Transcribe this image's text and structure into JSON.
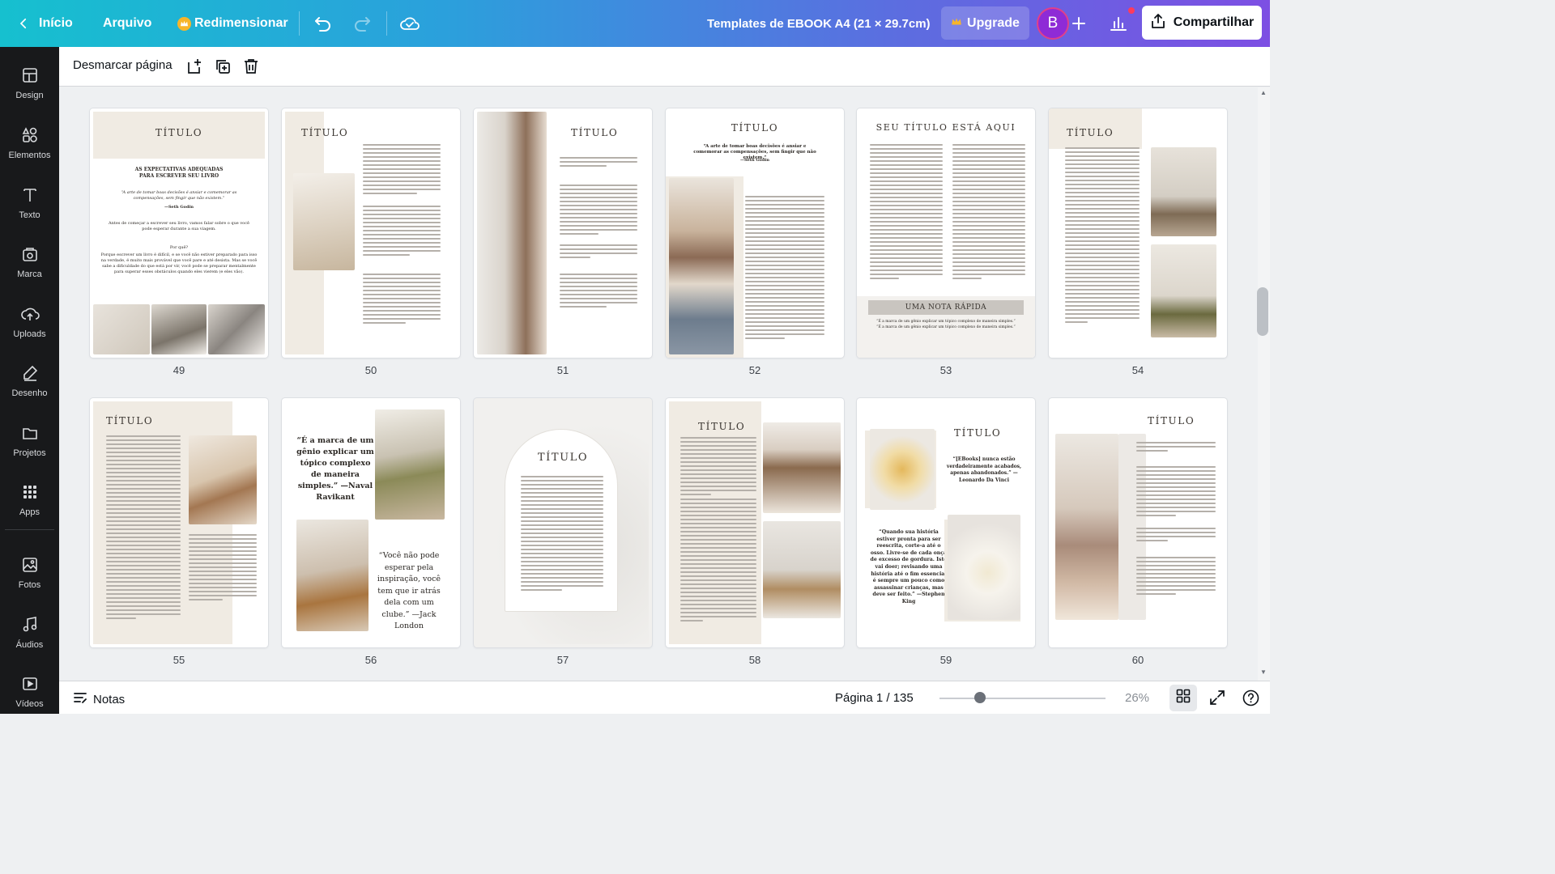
{
  "topbar": {
    "home_label": "Início",
    "file_label": "Arquivo",
    "resize_label": "Redimensionar",
    "doc_title": "Templates de EBOOK A4 (21 × 29.7cm)",
    "upgrade_label": "Upgrade",
    "avatar_initial": "B",
    "share_label": "Compartilhar",
    "brand_color": "#7d4fe3"
  },
  "sidebar": {
    "items": [
      {
        "label": "Design",
        "icon": "layout-icon"
      },
      {
        "label": "Elementos",
        "icon": "shapes-icon"
      },
      {
        "label": "Texto",
        "icon": "text-icon"
      },
      {
        "label": "Marca",
        "icon": "brand-icon"
      },
      {
        "label": "Uploads",
        "icon": "cloud-upload-icon"
      },
      {
        "label": "Desenho",
        "icon": "draw-icon"
      },
      {
        "label": "Projetos",
        "icon": "folder-icon"
      },
      {
        "label": "Apps",
        "icon": "apps-grid-icon"
      },
      {
        "label": "Fotos",
        "icon": "photo-icon"
      },
      {
        "label": "Áudios",
        "icon": "music-icon"
      },
      {
        "label": "Vídeos",
        "icon": "video-icon"
      }
    ]
  },
  "toolbar": {
    "deselect_label": "Desmarcar página"
  },
  "pages": {
    "p49": {
      "num": "49",
      "title": "TÍTULO",
      "heading": "AS EXPECTATIVAS ADEQUADAS PARA ESCREVER SEU LIVRO",
      "quote": "“A arte de tomar boas decisões é ansiar e comemorar as compensações, sem fingir que não existem.”",
      "author": "—Seth Godin",
      "body1": "Antes de começar a escrever seu livro, vamos falar sobre o que você pode esperar durante a sua viagem.",
      "question": "Por quê?",
      "body2": "Porque escrever um livro é difícil, e se você não estiver preparado para isso na verdade, é muito mais provável que você pare e até desista. Mas se você sabe a dificuldade do que está por vir, você pode se preparar mentalmente para superar esses obstáculos quando eles vierem (e eles vão)."
    },
    "p50": {
      "num": "50",
      "title": "TÍTULO"
    },
    "p51": {
      "num": "51",
      "title": "TÍTULO"
    },
    "p52": {
      "num": "52",
      "title": "TÍTULO",
      "quote": "“A arte de tomar boas decisões é ansiar e comemorar as compensações, sem fingir que não existem.”",
      "author": "—Seth Godin"
    },
    "p53": {
      "num": "53",
      "title": "SEU TÍTULO ESTÁ AQUI",
      "note_title": "UMA NOTA RÁPIDA",
      "note_line": "“É a marca de um gênio explicar um tópico complexo de maneira simples.”"
    },
    "p54": {
      "num": "54",
      "title": "TÍTULO"
    },
    "p55": {
      "num": "55",
      "title": "TÍTULO"
    },
    "p56": {
      "num": "56",
      "quote1": "“É a marca de um gênio explicar um tópico complexo de maneira simples.” —Naval Ravikant",
      "quote2": "“Você não pode esperar pela inspiração, você tem que ir atrás dela com um clube.” —Jack London"
    },
    "p57": {
      "num": "57",
      "title": "TÍTULO"
    },
    "p58": {
      "num": "58",
      "title": "TÍTULO"
    },
    "p59": {
      "num": "59",
      "title": "TÍTULO",
      "quote1": "“[EBooks] nunca estão verdadeiramente acabados, apenas abandonados.” — Leonardo Da Vinci",
      "quote2": "“Quando sua história estiver pronta para ser reescrita, corte-a até o osso. Livre-se de cada onça de excesso de gordura. Isto vai doer; revisando uma história até o fim essencial é sempre um pouco como assassinar crianças, mas deve ser feito.” —Stephen King"
    },
    "p60": {
      "num": "60",
      "title": "TÍTULO"
    }
  },
  "footer": {
    "notes_label": "Notas",
    "page_info": "Página 1 / 135",
    "zoom": "26%",
    "zoom_fraction": 0.26
  }
}
